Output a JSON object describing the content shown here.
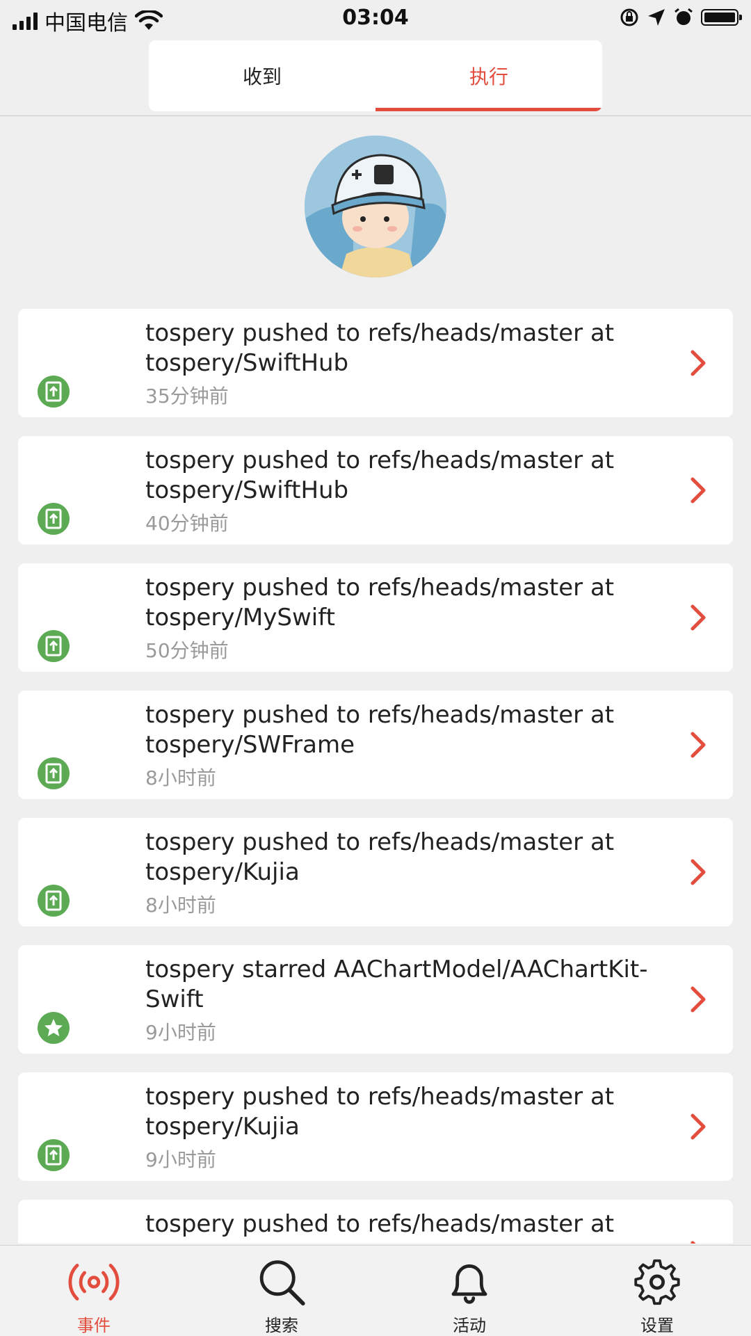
{
  "status_bar": {
    "carrier": "中国电信",
    "time": "03:04"
  },
  "segmented_tabs": [
    {
      "label": "收到",
      "active": false
    },
    {
      "label": "执行",
      "active": true
    }
  ],
  "accent_color": "#e24d3d",
  "event_icon_color": "#5cab54",
  "events": [
    {
      "title": "tospery pushed to refs/heads/master at tospery/SwiftHub",
      "time": "35分钟前",
      "icon": "push-icon"
    },
    {
      "title": "tospery pushed to refs/heads/master at tospery/SwiftHub",
      "time": "40分钟前",
      "icon": "push-icon"
    },
    {
      "title": "tospery pushed to refs/heads/master at tospery/MySwift",
      "time": "50分钟前",
      "icon": "push-icon"
    },
    {
      "title": "tospery pushed to refs/heads/master at tospery/SWFrame",
      "time": "8小时前",
      "icon": "push-icon"
    },
    {
      "title": "tospery pushed to refs/heads/master at tospery/Kujia",
      "time": "8小时前",
      "icon": "push-icon"
    },
    {
      "title": "tospery starred AAChartModel/AAChartKit-Swift",
      "time": "9小时前",
      "icon": "star-icon"
    },
    {
      "title": "tospery pushed to refs/heads/master at tospery/Kujia",
      "time": "9小时前",
      "icon": "push-icon"
    },
    {
      "title": "tospery pushed to refs/heads/master at",
      "time": "",
      "icon": "push-icon"
    }
  ],
  "tab_bar": [
    {
      "label": "事件",
      "icon": "broadcast-icon",
      "active": true
    },
    {
      "label": "搜索",
      "icon": "search-icon",
      "active": false
    },
    {
      "label": "活动",
      "icon": "bell-icon",
      "active": false
    },
    {
      "label": "设置",
      "icon": "gear-icon",
      "active": false
    }
  ]
}
